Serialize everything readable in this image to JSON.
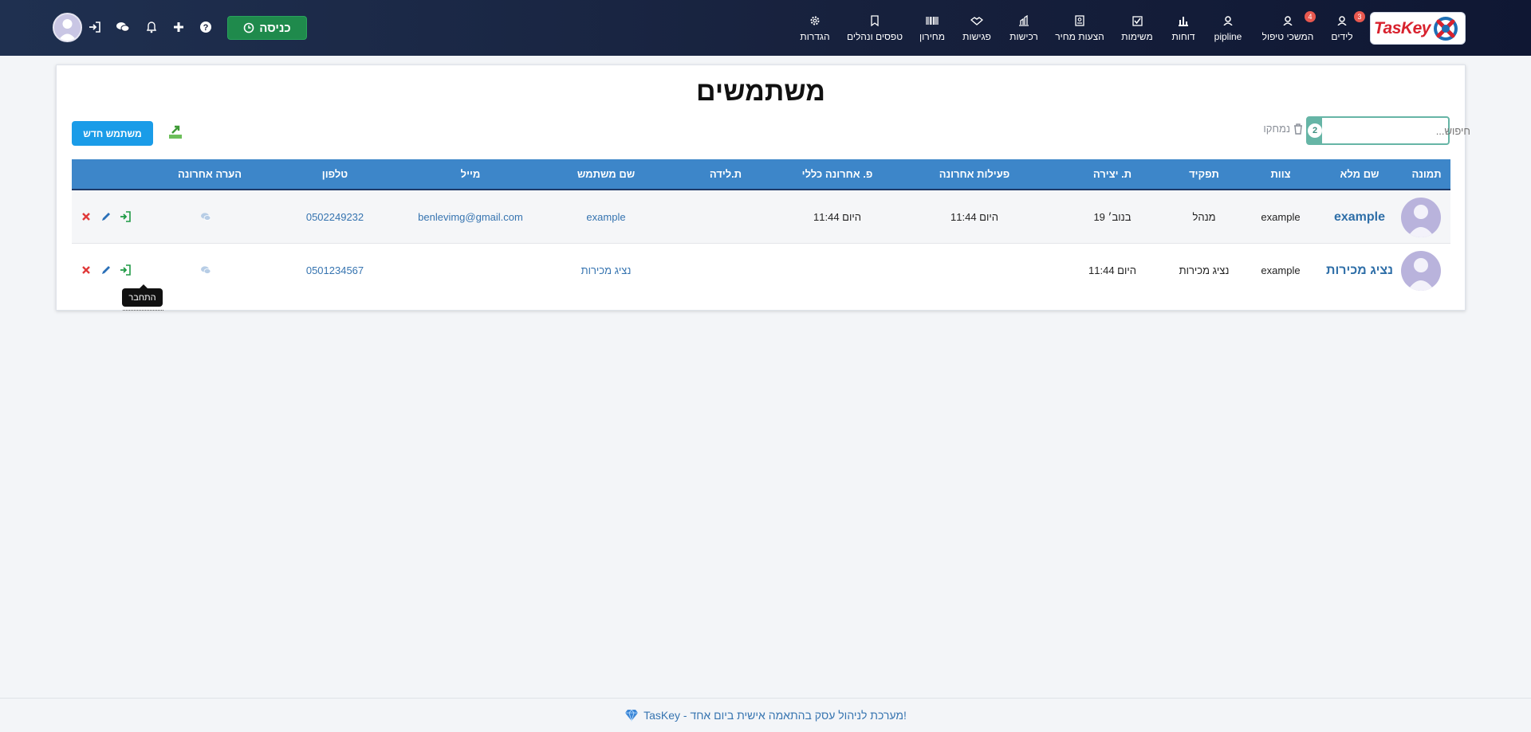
{
  "nav": {
    "logo_text": "TasKey",
    "items": [
      {
        "label": "לידים",
        "icon": "lead-icon",
        "badge": "3"
      },
      {
        "label": "המשכי טיפול",
        "icon": "followup-icon",
        "badge": "4"
      },
      {
        "label": "pipline",
        "icon": "pipeline-icon",
        "badge": ""
      },
      {
        "label": "דוחות",
        "icon": "bar-chart-icon",
        "badge": ""
      },
      {
        "label": "משימות",
        "icon": "checkbox-icon",
        "badge": ""
      },
      {
        "label": "הצעות מחיר",
        "icon": "quote-doc-icon",
        "badge": ""
      },
      {
        "label": "רכישות",
        "icon": "purchase-icon",
        "badge": ""
      },
      {
        "label": "פגישות",
        "icon": "handshake-icon",
        "badge": ""
      },
      {
        "label": "מחירון",
        "icon": "barcode-icon",
        "badge": ""
      },
      {
        "label": "טפסים ונהלים",
        "icon": "forms-icon",
        "badge": ""
      },
      {
        "label": "הגדרות",
        "icon": "settings-gear-icon",
        "badge": ""
      }
    ],
    "enter_button": "כניסה"
  },
  "page": {
    "title": "משתמשים",
    "search_placeholder": "חיפוש...",
    "count": "2",
    "deleted_label": "נמחקו",
    "new_user_button": "משתמש חדש"
  },
  "table": {
    "columns": [
      "תמונה",
      "שם מלא",
      "צוות",
      "תפקיד",
      "ת. יצירה",
      "פעילות אחרונה",
      "פ. אחרונה כללי",
      "ת.לידה",
      "שם משתמש",
      "מייל",
      "טלפון",
      "הערה אחרונה"
    ],
    "rows": [
      {
        "full_name": "example",
        "team": "example",
        "role": "מנהל",
        "created": "19 בנוב׳",
        "last_activity": "היום 11:44",
        "last_general": "היום 11:44",
        "birthday": "",
        "username": "example",
        "email": "benlevimg@gmail.com",
        "phone": "0502249232"
      },
      {
        "full_name": "נציג מכירות",
        "team": "example",
        "role": "נציג מכירות",
        "created": "היום 11:44",
        "last_activity": "",
        "last_general": "",
        "birthday": "",
        "username": "נציג מכירות",
        "email": "",
        "phone": "0501234567"
      }
    ],
    "tooltip": "התחבר"
  },
  "footer": {
    "text": "TasKey - מערכת לניהול עסק בהתאמה אישית ביום אחד!"
  },
  "colors": {
    "nav_bg": "#17213d",
    "accent_blue": "#1a9ce8",
    "table_header": "#3d86c9",
    "enter_green": "#1f8a4c",
    "teal": "#66b5a6",
    "badge_red": "#e9584f"
  }
}
